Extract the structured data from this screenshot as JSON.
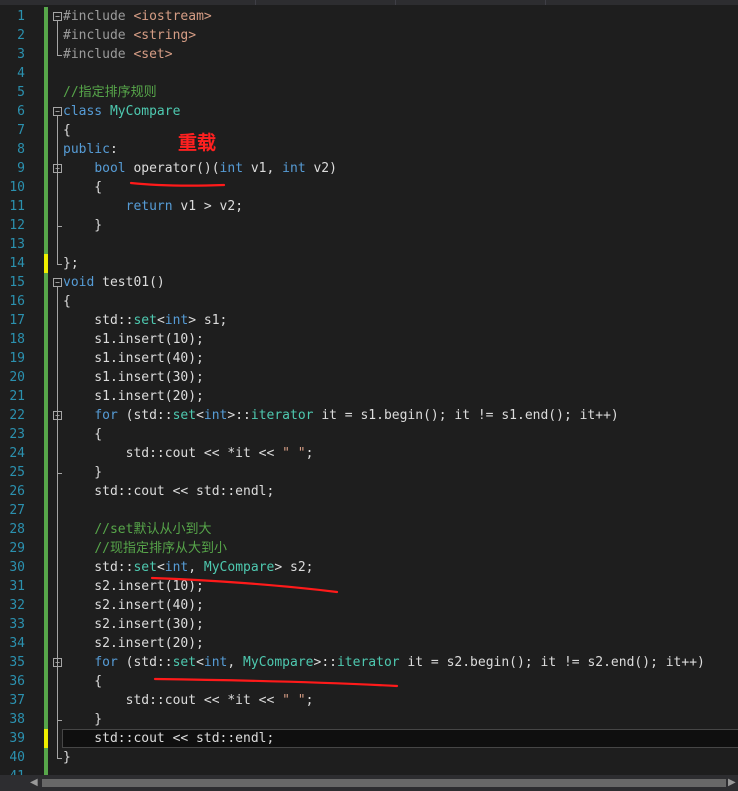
{
  "editor": {
    "line_numbers": [
      "1",
      "2",
      "3",
      "4",
      "5",
      "6",
      "7",
      "8",
      "9",
      "10",
      "11",
      "12",
      "13",
      "14",
      "15",
      "16",
      "17",
      "18",
      "19",
      "20",
      "21",
      "22",
      "23",
      "24",
      "25",
      "26",
      "27",
      "28",
      "29",
      "30",
      "31",
      "32",
      "33",
      "34",
      "35",
      "36",
      "37",
      "38",
      "39",
      "40",
      "41"
    ],
    "lines": [
      [
        [
          "#include ",
          "inc"
        ],
        [
          "<iostream>",
          "st"
        ]
      ],
      [
        [
          "#include ",
          "inc"
        ],
        [
          "<string>",
          "st"
        ]
      ],
      [
        [
          "#include ",
          "inc"
        ],
        [
          "<set>",
          "st"
        ]
      ],
      [],
      [
        [
          "//指定排序规则",
          "cm"
        ]
      ],
      [
        [
          "class ",
          "kw"
        ],
        [
          "MyCompare",
          "ty"
        ]
      ],
      [
        [
          "{",
          ""
        ]
      ],
      [
        [
          "public",
          "kw"
        ],
        [
          ":",
          ""
        ]
      ],
      [
        [
          "    ",
          ""
        ],
        [
          "bool ",
          "kw"
        ],
        [
          "operator()(",
          ""
        ],
        [
          "int ",
          "kw"
        ],
        [
          "v1, ",
          ""
        ],
        [
          "int ",
          "kw"
        ],
        [
          "v2)",
          ""
        ]
      ],
      [
        [
          "    {",
          ""
        ]
      ],
      [
        [
          "        ",
          ""
        ],
        [
          "return ",
          "kw"
        ],
        [
          "v1 > v2;",
          ""
        ]
      ],
      [
        [
          "    }",
          ""
        ]
      ],
      [],
      [
        [
          "};",
          ""
        ]
      ],
      [
        [
          "void ",
          "kw"
        ],
        [
          "test01()",
          ""
        ]
      ],
      [
        [
          "{",
          ""
        ]
      ],
      [
        [
          "    std::",
          ""
        ],
        [
          "set",
          "ty"
        ],
        [
          "<",
          ""
        ],
        [
          "int",
          "kw"
        ],
        [
          "> s1;",
          ""
        ]
      ],
      [
        [
          "    s1.insert(10);",
          ""
        ]
      ],
      [
        [
          "    s1.insert(40);",
          ""
        ]
      ],
      [
        [
          "    s1.insert(30);",
          ""
        ]
      ],
      [
        [
          "    s1.insert(20);",
          ""
        ]
      ],
      [
        [
          "    ",
          ""
        ],
        [
          "for ",
          "kw"
        ],
        [
          "(std::",
          ""
        ],
        [
          "set",
          "ty"
        ],
        [
          "<",
          ""
        ],
        [
          "int",
          "kw"
        ],
        [
          ">::",
          ""
        ],
        [
          "iterator",
          "ty"
        ],
        [
          " it = s1.begin(); it != s1.end(); it++)",
          ""
        ]
      ],
      [
        [
          "    {",
          ""
        ]
      ],
      [
        [
          "        std::cout << *it << ",
          ""
        ],
        [
          "\" \"",
          "st"
        ],
        [
          ";",
          ""
        ]
      ],
      [
        [
          "    }",
          ""
        ]
      ],
      [
        [
          "    std::cout << std::endl;",
          ""
        ]
      ],
      [],
      [
        [
          "    ",
          ""
        ],
        [
          "//set默认从小到大",
          "cm"
        ]
      ],
      [
        [
          "    ",
          ""
        ],
        [
          "//现指定排序从大到小",
          "cm"
        ]
      ],
      [
        [
          "    std::",
          ""
        ],
        [
          "set",
          "ty"
        ],
        [
          "<",
          ""
        ],
        [
          "int",
          "kw"
        ],
        [
          ", ",
          ""
        ],
        [
          "MyCompare",
          "ty"
        ],
        [
          "> s2;",
          ""
        ]
      ],
      [
        [
          "    s2.insert(10);",
          ""
        ]
      ],
      [
        [
          "    s2.insert(40);",
          ""
        ]
      ],
      [
        [
          "    s2.insert(30);",
          ""
        ]
      ],
      [
        [
          "    s2.insert(20);",
          ""
        ]
      ],
      [
        [
          "    ",
          ""
        ],
        [
          "for ",
          "kw"
        ],
        [
          "(std::",
          ""
        ],
        [
          "set",
          "ty"
        ],
        [
          "<",
          ""
        ],
        [
          "int",
          "kw"
        ],
        [
          ", ",
          ""
        ],
        [
          "MyCompare",
          "ty"
        ],
        [
          ">::",
          ""
        ],
        [
          "iterator",
          "ty"
        ],
        [
          " it = s2.begin(); it != s2.end(); it++)",
          ""
        ]
      ],
      [
        [
          "    {",
          ""
        ]
      ],
      [
        [
          "        std::cout << *it << ",
          ""
        ],
        [
          "\" \"",
          "st"
        ],
        [
          ";",
          ""
        ]
      ],
      [
        [
          "    }",
          ""
        ]
      ],
      [
        [
          "    std::cout << std::endl;",
          ""
        ]
      ],
      [
        [
          "}",
          ""
        ]
      ],
      []
    ],
    "modified_lines": [
      14,
      39
    ],
    "current_line": 39,
    "fold_markers": [
      1,
      6,
      9,
      15,
      22,
      35
    ]
  },
  "annotation": {
    "label": "重载",
    "color": "#ff2020"
  },
  "icons": {
    "scroll_left": "scroll-left-arrow-icon",
    "scroll_right": "scroll-right-arrow-icon",
    "fold": "collapse-minus-icon"
  }
}
